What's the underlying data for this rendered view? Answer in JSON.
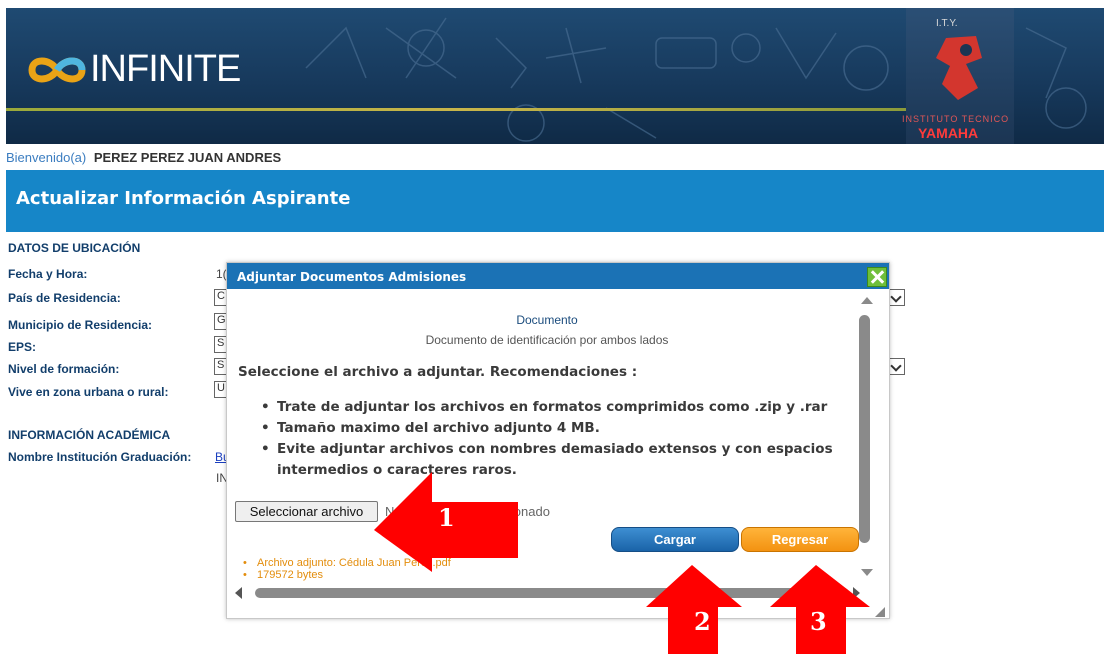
{
  "header": {
    "logo_text": "INFINITE",
    "ity_label": "I.T.Y.",
    "institute_label": "INSTITUTO TECNICO",
    "yamaha_label": "YAMAHA"
  },
  "welcome": {
    "label": "Bienvenido(a)",
    "name": "PEREZ PEREZ JUAN ANDRES"
  },
  "page_title": "Actualizar Información Aspirante",
  "form": {
    "section_location": "DATOS DE UBICACIÓN",
    "fields": [
      {
        "label": "Fecha y Hora:",
        "value_visible": "1("
      },
      {
        "label": "País de Residencia:",
        "value_visible": "C"
      },
      {
        "label": "Municipio de Residencia:",
        "value_visible": "G"
      },
      {
        "label": "EPS:",
        "value_visible": "S"
      },
      {
        "label": "Nivel de formación:",
        "value_visible": "S"
      },
      {
        "label": "Vive en zona urbana o rural:",
        "value_visible": "U"
      }
    ],
    "section_academic": "INFORMACIÓN ACADÉMICA",
    "institution_label": "Nombre Institución Graduación:",
    "institution_link_visible": "Bu",
    "institution_extra_visible": "IN"
  },
  "dialog": {
    "title": "Adjuntar Documentos Admisiones",
    "document_title": "Documento",
    "document_description": "Documento de identificación por ambos lados",
    "instruction": "Seleccione el archivo a adjuntar. Recomendaciones :",
    "recommendations": [
      "Trate de adjuntar los archivos en formatos comprimidos como .zip y .rar",
      "Tamaño maximo del archivo adjunto 4 MB.",
      "Evite adjuntar archivos con nombres demasiado extensos y con espacios intermedios o caracteres raros."
    ],
    "file_button_label": "Seleccionar archivo",
    "file_status_prefix": "N",
    "file_status_suffix": "cionado",
    "upload_button_label": "Cargar",
    "back_button_label": "Regresar",
    "attachment": {
      "file_line": "Archivo adjunto: Cédula Juan Perez.pdf",
      "size_line": "179572 bytes"
    }
  },
  "annotations": [
    "1",
    "2",
    "3"
  ],
  "colors": {
    "title_bar": "#1686c8",
    "dialog_title": "#1b72b5",
    "upload_button": "#1a63a8",
    "back_button": "#f39211",
    "attachment_text": "#e38d0c",
    "arrow": "#ff0000"
  }
}
